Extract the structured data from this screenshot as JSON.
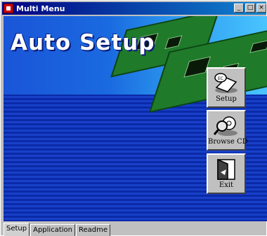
{
  "window": {
    "title": "Multi Menu",
    "controls": [
      "minimize",
      "maximize",
      "close"
    ]
  },
  "banner": {
    "heading": "Auto Setup"
  },
  "buttons": [
    {
      "label": "Setup",
      "icon": "book-icon"
    },
    {
      "label": "Browse CD",
      "icon": "magnifier-icon"
    },
    {
      "label": "Exit",
      "icon": "door-icon"
    }
  ],
  "tabs": [
    {
      "label": "Setup",
      "active": true
    },
    {
      "label": "Application",
      "active": false
    },
    {
      "label": "Readme",
      "active": false
    }
  ],
  "colors": {
    "titlebar": "#000080",
    "background_stripes": "#1840c8",
    "board_green": "#1f7a2a"
  }
}
